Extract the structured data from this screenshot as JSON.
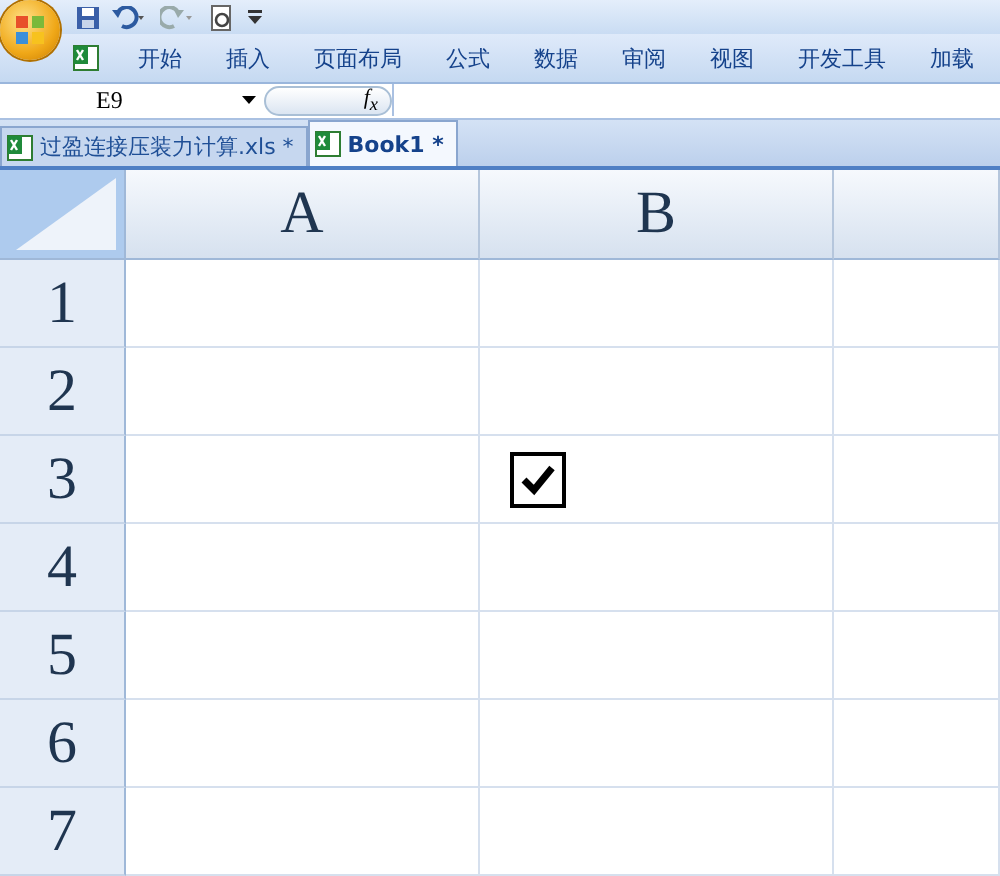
{
  "ribbon_tabs": [
    {
      "label": "开始"
    },
    {
      "label": "插入"
    },
    {
      "label": "页面布局"
    },
    {
      "label": "公式"
    },
    {
      "label": "数据"
    },
    {
      "label": "审阅"
    },
    {
      "label": "视图"
    },
    {
      "label": "开发工具"
    },
    {
      "label": "加载"
    }
  ],
  "formula_bar": {
    "name_box": "E9",
    "function_button": "f$_{x}$"
  },
  "workbook_tabs": [
    {
      "label": "过盈连接压装力计算.xls *",
      "selected": false
    },
    {
      "label": "Book1 *",
      "selected": true
    }
  ],
  "grid": {
    "columns": [
      "A",
      "B"
    ],
    "rows": [
      {
        "label": "1",
        "cells": [
          {
            "kind": "empty"
          },
          {
            "kind": "empty"
          },
          {
            "kind": "empty"
          }
        ]
      },
      {
        "label": "2",
        "cells": [
          {
            "kind": "empty"
          },
          {
            "kind": "empty"
          },
          {
            "kind": "empty"
          }
        ]
      },
      {
        "label": "3",
        "cells": [
          {
            "kind": "empty"
          },
          {
            "kind": "checkbox",
            "checked": true
          },
          {
            "kind": "empty"
          }
        ]
      },
      {
        "label": "4",
        "cells": [
          {
            "kind": "empty"
          },
          {
            "kind": "empty"
          },
          {
            "kind": "empty"
          }
        ]
      },
      {
        "label": "5",
        "cells": [
          {
            "kind": "empty"
          },
          {
            "kind": "empty"
          },
          {
            "kind": "empty"
          }
        ]
      },
      {
        "label": "6",
        "cells": [
          {
            "kind": "empty"
          },
          {
            "kind": "empty"
          },
          {
            "kind": "empty"
          }
        ]
      },
      {
        "label": "7",
        "cells": [
          {
            "kind": "empty"
          },
          {
            "kind": "empty"
          },
          {
            "kind": "empty"
          }
        ]
      }
    ]
  }
}
